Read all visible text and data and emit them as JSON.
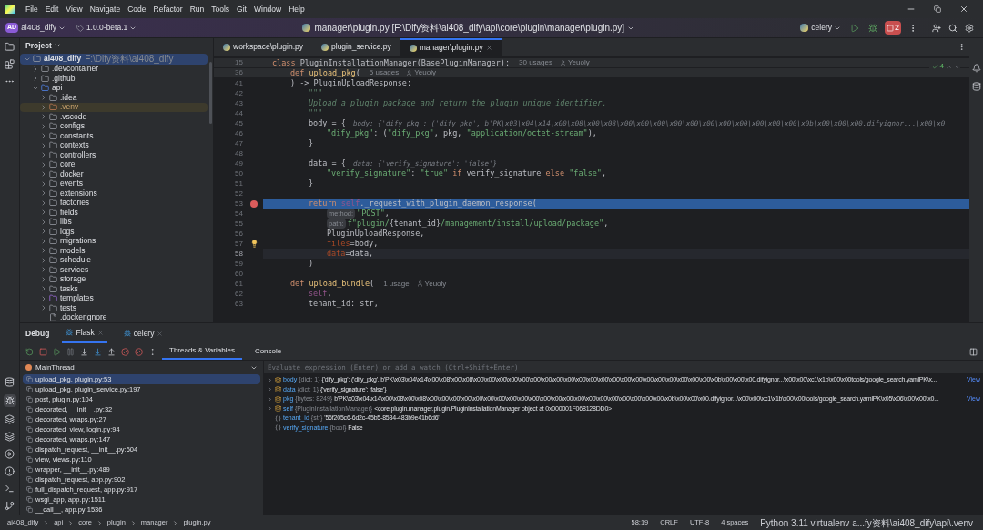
{
  "menu": [
    "File",
    "Edit",
    "View",
    "Navigate",
    "Code",
    "Refactor",
    "Run",
    "Tools",
    "Git",
    "Window",
    "Help"
  ],
  "toolbar": {
    "project_badge": "AD",
    "project": "ai408_dify",
    "branch": "1.0.0-beta.1",
    "title": "manager\\plugin.py [F:\\Dify资料\\ai408_dify\\api\\core\\plugin\\manager\\plugin.py]",
    "run_config": "celery",
    "stop_badge": "2"
  },
  "project_panel": {
    "title": "Project",
    "tree": [
      {
        "name": "ai408_dify",
        "path": "F:\\Dify资料\\ai408_dify",
        "kind": "folder",
        "expanded": true,
        "selected": true,
        "children": [
          {
            "name": ".devcontainer",
            "kind": "folder",
            "expanded": false,
            "selected": false
          },
          {
            "name": ".github",
            "kind": "folder",
            "expanded": false,
            "selected": false
          },
          {
            "name": "api",
            "kind": "source",
            "expanded": true,
            "selected": false,
            "children": [
              {
                "name": ".idea",
                "kind": "folder",
                "expanded": false,
                "selected": false
              },
              {
                "name": ".venv",
                "kind": "excluded",
                "expanded": false,
                "selected": false
              },
              {
                "name": ".vscode",
                "kind": "folder",
                "expanded": false,
                "selected": false
              },
              {
                "name": "configs",
                "kind": "package",
                "expanded": false,
                "selected": false
              },
              {
                "name": "constants",
                "kind": "package",
                "expanded": false,
                "selected": false
              },
              {
                "name": "contexts",
                "kind": "package",
                "expanded": false,
                "selected": false
              },
              {
                "name": "controllers",
                "kind": "package",
                "expanded": false,
                "selected": false
              },
              {
                "name": "core",
                "kind": "package",
                "expanded": false,
                "selected": false
              },
              {
                "name": "docker",
                "kind": "folder",
                "expanded": false,
                "selected": false
              },
              {
                "name": "events",
                "kind": "package",
                "expanded": false,
                "selected": false
              },
              {
                "name": "extensions",
                "kind": "package",
                "expanded": false,
                "selected": false
              },
              {
                "name": "factories",
                "kind": "package",
                "expanded": false,
                "selected": false
              },
              {
                "name": "fields",
                "kind": "package",
                "expanded": false,
                "selected": false
              },
              {
                "name": "libs",
                "kind": "package",
                "expanded": false,
                "selected": false
              },
              {
                "name": "logs",
                "kind": "folder",
                "expanded": false,
                "selected": false
              },
              {
                "name": "migrations",
                "kind": "folder",
                "expanded": false,
                "selected": false
              },
              {
                "name": "models",
                "kind": "package",
                "expanded": false,
                "selected": false
              },
              {
                "name": "schedule",
                "kind": "folder",
                "expanded": false,
                "selected": false
              },
              {
                "name": "services",
                "kind": "package",
                "expanded": false,
                "selected": false
              },
              {
                "name": "storage",
                "kind": "folder",
                "expanded": false,
                "selected": false
              },
              {
                "name": "tasks",
                "kind": "package",
                "expanded": false,
                "selected": false
              },
              {
                "name": "templates",
                "kind": "templates",
                "expanded": false,
                "selected": false
              },
              {
                "name": "tests",
                "kind": "package",
                "expanded": false,
                "selected": false
              },
              {
                "name": ".dockerignore",
                "kind": "file",
                "selected": false
              }
            ]
          }
        ]
      }
    ]
  },
  "editor": {
    "tabs": [
      {
        "label": "workspace\\plugin.py",
        "selected": false
      },
      {
        "label": "plugin_service.py",
        "selected": false
      },
      {
        "label": "manager\\plugin.py",
        "selected": true
      }
    ],
    "problems": "4",
    "lines": [
      {
        "n": "15",
        "sticky": true,
        "t": [
          {
            "kind": "kw",
            "text": "class "
          },
          {
            "kind": "plain",
            "text": "PluginInstallationManager(BasePluginManager):"
          },
          {
            "kind": "usage",
            "text": "30 usages"
          },
          {
            "kind": "author",
            "text": "Yeuoly"
          }
        ],
        "children": [
          {
            "n": "36",
            "sticky": true,
            "t": [
              {
                "kind": "kw",
                "text": "def "
              },
              {
                "kind": "fn",
                "text": "upload_pkg"
              },
              {
                "kind": "plain",
                "text": "("
              },
              {
                "kind": "usage",
                "text": "5 usages"
              },
              {
                "kind": "author",
                "text": "Yeuoly"
              }
            ]
          },
          {
            "n": "41",
            "t": [
              {
                "kind": "plain",
                "text": ") -> PluginUploadResponse:"
              }
            ],
            "children": [
              {
                "n": "42",
                "t": [
                  {
                    "kind": "doc",
                    "text": "\"\"\""
                  }
                ]
              },
              {
                "n": "43",
                "t": [
                  {
                    "kind": "doc",
                    "text": "Upload a plugin package and return the plugin unique identifier."
                  }
                ]
              },
              {
                "n": "44",
                "t": [
                  {
                    "kind": "doc",
                    "text": "\"\"\""
                  }
                ]
              },
              {
                "n": "45",
                "t": [
                  {
                    "kind": "plain",
                    "text": "body = {"
                  },
                  {
                    "kind": "hint",
                    "text": "body: {'dify_pkg': ('dify_pkg', b'PK\\x03\\x04\\x14\\x00\\x08\\x00\\x08\\x00\\x00\\x00\\x00\\x00\\x00\\x00\\x00\\x00\\x00\\x00\\x0b\\x00\\x00\\x00.difyignor...\\x00\\x0"
                  }
                ],
                "children": [
                  {
                    "n": "46",
                    "t": [
                      {
                        "kind": "str",
                        "text": "\"dify_pkg\""
                      },
                      {
                        "kind": "plain",
                        "text": ": ("
                      },
                      {
                        "kind": "str",
                        "text": "\"dify_pkg\""
                      },
                      {
                        "kind": "plain",
                        "text": ", pkg, "
                      },
                      {
                        "kind": "str",
                        "text": "\"application/octet-stream\""
                      },
                      {
                        "kind": "plain",
                        "text": "),"
                      }
                    ]
                  }
                ]
              },
              {
                "n": "47",
                "t": [
                  {
                    "kind": "plain",
                    "text": "}"
                  }
                ]
              },
              {
                "n": "48"
              },
              {
                "n": "49",
                "t": [
                  {
                    "kind": "plain",
                    "text": "data = {"
                  },
                  {
                    "kind": "hint",
                    "text": "data: {'verify_signature': 'false'}"
                  }
                ],
                "children": [
                  {
                    "n": "50",
                    "t": [
                      {
                        "kind": "str",
                        "text": "\"verify_signature\""
                      },
                      {
                        "kind": "plain",
                        "text": ": "
                      },
                      {
                        "kind": "str",
                        "text": "\"true\" "
                      },
                      {
                        "kind": "kw",
                        "text": "if "
                      },
                      {
                        "kind": "plain",
                        "text": "verify_signature "
                      },
                      {
                        "kind": "kw",
                        "text": "else "
                      },
                      {
                        "kind": "str",
                        "text": "\"false\""
                      },
                      {
                        "kind": "plain",
                        "text": ","
                      }
                    ]
                  }
                ]
              },
              {
                "n": "51",
                "t": [
                  {
                    "kind": "plain",
                    "text": "}"
                  }
                ]
              },
              {
                "n": "52"
              },
              {
                "n": "53",
                "execution": true,
                "breakpoint": true,
                "t": [
                  {
                    "kind": "kw",
                    "text": "return "
                  },
                  {
                    "kind": "self",
                    "text": "self"
                  },
                  {
                    "kind": "plain",
                    "text": "._request_with_plugin_daemon_response("
                  }
                ],
                "children": [
                  {
                    "n": "54",
                    "t": [
                      {
                        "kind": "chip",
                        "text": "method:"
                      },
                      {
                        "kind": "str",
                        "text": "\"POST\""
                      },
                      {
                        "kind": "plain",
                        "text": ","
                      }
                    ]
                  },
                  {
                    "n": "55",
                    "t": [
                      {
                        "kind": "chip",
                        "text": "path:"
                      },
                      {
                        "kind": "str",
                        "text": "f\"plugin/"
                      },
                      {
                        "kind": "plain",
                        "text": "{tenant_id}"
                      },
                      {
                        "kind": "str",
                        "text": "/management/install/upload/package\""
                      },
                      {
                        "kind": "plain",
                        "text": ","
                      }
                    ]
                  },
                  {
                    "n": "56",
                    "t": [
                      {
                        "kind": "plain",
                        "text": "PluginUploadResponse,"
                      }
                    ]
                  },
                  {
                    "n": "57",
                    "lightbulb": true,
                    "t": [
                      {
                        "kind": "arg",
                        "text": "files"
                      },
                      {
                        "kind": "plain",
                        "text": "=body,"
                      }
                    ]
                  },
                  {
                    "n": "58",
                    "caret": true,
                    "t": [
                      {
                        "kind": "arg",
                        "text": "data"
                      },
                      {
                        "kind": "plain",
                        "text": "=data,"
                      }
                    ]
                  }
                ]
              },
              {
                "n": "59",
                "t": [
                  {
                    "kind": "plain",
                    "text": ")"
                  }
                ]
              },
              {
                "n": "60"
              }
            ]
          },
          {
            "n": "61",
            "t": [
              {
                "kind": "kw",
                "text": "def "
              },
              {
                "kind": "fn",
                "text": "upload_bundle"
              },
              {
                "kind": "plain",
                "text": "("
              },
              {
                "kind": "usage",
                "text": "1 usage"
              },
              {
                "kind": "author",
                "text": "Yeuoly"
              }
            ],
            "children": [
              {
                "n": "62",
                "t": [
                  {
                    "kind": "self",
                    "text": "self"
                  },
                  {
                    "kind": "plain",
                    "text": ","
                  }
                ]
              },
              {
                "n": "63",
                "t": [
                  {
                    "kind": "plain",
                    "text": "tenant_id: str,"
                  }
                ]
              }
            ]
          }
        ]
      }
    ]
  },
  "debug": {
    "title": "Debug",
    "sessions": [
      {
        "label": "Flask",
        "selected": true
      },
      {
        "label": "celery",
        "selected": false
      }
    ],
    "tabs": [
      {
        "label": "Threads & Variables",
        "selected": true
      },
      {
        "label": "Console",
        "selected": false
      }
    ],
    "thread": "MainThread",
    "frames": [
      {
        "label": "upload_pkg, plugin.py:53",
        "selected": true
      },
      {
        "label": "upload_pkg, plugin_service.py:197",
        "selected": false
      },
      {
        "label": "post, plugin.py:104",
        "selected": false
      },
      {
        "label": "decorated, __init__.py:32",
        "selected": false
      },
      {
        "label": "decorated, wraps.py:27",
        "selected": false
      },
      {
        "label": "decorated_view, login.py:94",
        "selected": false
      },
      {
        "label": "decorated, wraps.py:147",
        "selected": false
      },
      {
        "label": "dispatch_request, __init__.py:604",
        "selected": false
      },
      {
        "label": "view, views.py:110",
        "selected": false
      },
      {
        "label": "wrapper, __init__.py:489",
        "selected": false
      },
      {
        "label": "dispatch_request, app.py:902",
        "selected": false
      },
      {
        "label": "full_dispatch_request, app.py:917",
        "selected": false
      },
      {
        "label": "wsgi_app, app.py:1511",
        "selected": false
      },
      {
        "label": "__call__, app.py:1536",
        "selected": false
      }
    ],
    "eval_placeholder": "Evaluate expression (Enter) or add a watch (Ctrl+Shift+Enter)",
    "variables": [
      {
        "name": "body",
        "type": "{dict: 1}",
        "value": "{'dify_pkg': ('dify_pkg', b'PK\\x03\\x04\\x14\\x00\\x08\\x00\\x08\\x00\\x00\\x00\\x00\\x00\\x00\\x00\\x00\\x00\\x00\\x00\\x00\\x00\\x00\\x00\\x00\\x00\\x00\\x00\\x00\\x00\\x0b\\x00\\x00\\x00.difyignor...\\x00\\x00\\xc1\\x1b\\x00\\x00tools/google_search.yamlPK\\x...",
        "link": "View",
        "kind": "collection",
        "expandable": true
      },
      {
        "name": "data",
        "type": "{dict: 1}",
        "value": "{'verify_signature': 'false'}",
        "kind": "collection",
        "expandable": true
      },
      {
        "name": "pkg",
        "type": "{bytes: 8249}",
        "value": "b'PK\\x03\\x04\\x14\\x00\\x08\\x00\\x08\\x00\\x00\\x00\\x00\\x00\\x00\\x00\\x00\\x00\\x00\\x00\\x00\\x00\\x00\\x00\\x00\\x00\\x00\\x00\\x00\\x00\\x0b\\x00\\x00\\x00.difyignor...\\x00\\x00\\xc1\\x1b\\x00\\x00tools/google_search.yamlPK\\x05\\x06\\x00\\x00\\x0...",
        "link": "View",
        "kind": "collection",
        "expandable": true
      },
      {
        "name": "self",
        "type": "{PluginInstallationManager}",
        "value": "<core.plugin.manager.plugin.PluginInstallationManager object at 0x000001F068128DD0>",
        "kind": "collection",
        "expandable": true
      },
      {
        "name": "tenant_id",
        "type": "{str}",
        "value": "'56f205c6-6d2c-45b5-8584-483b9e41b6d6'",
        "kind": "scalar",
        "expandable": false
      },
      {
        "name": "verify_signature",
        "type": "{bool}",
        "value": "False",
        "kind": "scalar",
        "expandable": false
      }
    ]
  },
  "status_bar": {
    "breadcrumbs": [
      "ai408_dify",
      "api",
      "core",
      "plugin",
      "manager",
      "plugin.py"
    ],
    "position": "58:19",
    "line_sep": "CRLF",
    "encoding": "UTF-8",
    "indent": "4 spaces",
    "interpreter": "Python 3.11 virtualenv a...fy资料\\ai408_dify\\api\\.venv"
  }
}
